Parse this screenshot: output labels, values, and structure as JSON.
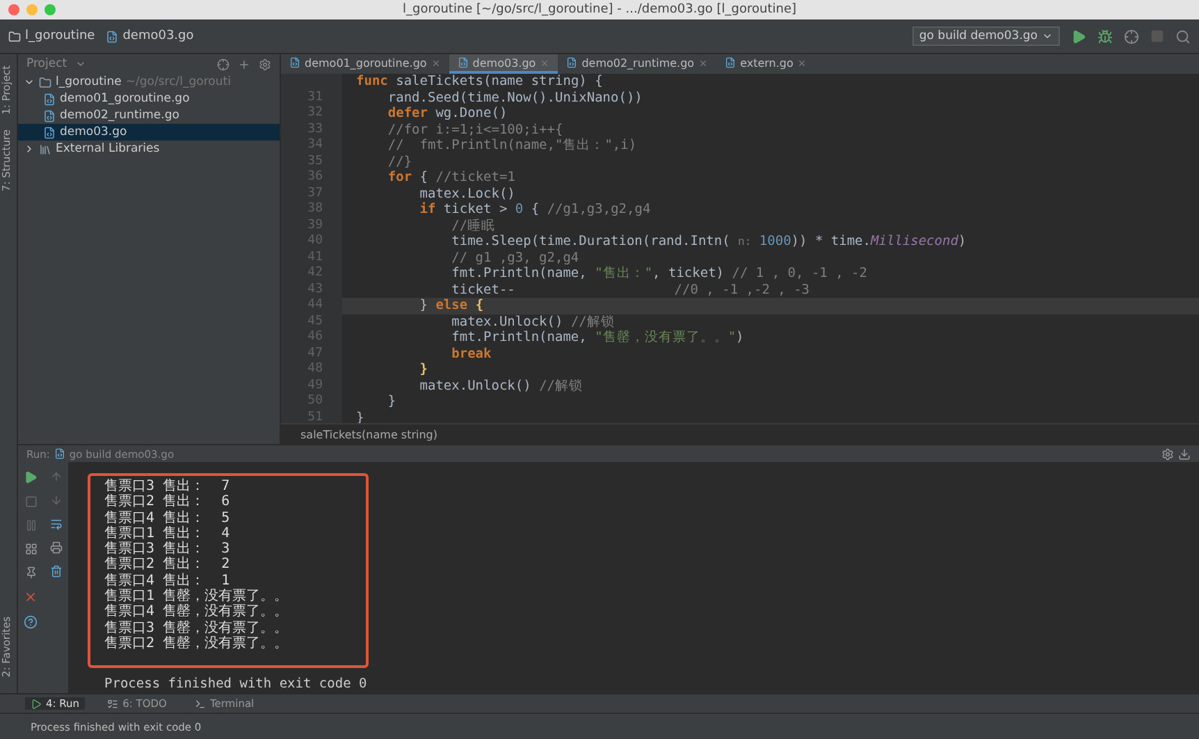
{
  "window": {
    "title": "l_goroutine [~/go/src/l_goroutine] - .../demo03.go [l_goroutine]"
  },
  "nav_bar": {
    "breadcrumbs": [
      "l_goroutine",
      "demo03.go"
    ],
    "run_config": "go build demo03.go"
  },
  "side_strip": {
    "top": [
      "1: Project",
      "7: Structure"
    ],
    "bottom": [
      "2: Favorites"
    ]
  },
  "project_panel": {
    "title": "Project",
    "tree": [
      {
        "label": "l_goroutine",
        "path": "~/go/src/l_gorouti",
        "kind": "folder",
        "expanded": true,
        "selected": false,
        "children": [
          {
            "label": "demo01_goroutine.go",
            "kind": "file",
            "selected": false
          },
          {
            "label": "demo02_runtime.go",
            "kind": "file",
            "selected": false
          },
          {
            "label": "demo03.go",
            "kind": "file",
            "selected": true
          }
        ]
      },
      {
        "label": "External Libraries",
        "kind": "library",
        "expanded": false,
        "selected": false
      }
    ]
  },
  "editor": {
    "tabs": [
      {
        "label": "demo01_goroutine.go",
        "selected": false
      },
      {
        "label": "demo03.go",
        "selected": true
      },
      {
        "label": "demo02_runtime.go",
        "selected": false
      },
      {
        "label": "extern.go",
        "selected": false
      }
    ],
    "lines": [
      {
        "current": false,
        "tokens": [
          {
            "kind": "kw",
            "t": "func "
          },
          {
            "kind": "plain",
            "t": "saleTickets(name string) {"
          }
        ]
      },
      {
        "number": "31",
        "current": false,
        "tokens": [
          {
            "kind": "plain",
            "t": "    rand.Seed(time.Now().UnixNano())"
          }
        ]
      },
      {
        "number": "32",
        "current": false,
        "tokens": [
          {
            "kind": "kw",
            "t": "    defer "
          },
          {
            "kind": "plain",
            "t": "wg.Done()"
          }
        ]
      },
      {
        "number": "33",
        "current": false,
        "tokens": [
          {
            "kind": "comment",
            "t": "    //for i:=1;i<=100;i++{"
          }
        ]
      },
      {
        "number": "34",
        "current": false,
        "tokens": [
          {
            "kind": "comment",
            "t": "    //  fmt.Println(name,\"售出：\",i)"
          }
        ]
      },
      {
        "number": "35",
        "current": false,
        "tokens": [
          {
            "kind": "comment",
            "t": "    //}"
          }
        ]
      },
      {
        "number": "36",
        "current": false,
        "tokens": [
          {
            "kind": "kw",
            "t": "    for "
          },
          {
            "kind": "plain",
            "t": "{ "
          },
          {
            "kind": "comment",
            "t": "//ticket=1"
          }
        ]
      },
      {
        "number": "37",
        "current": false,
        "tokens": [
          {
            "kind": "plain",
            "t": "        matex.Lock()"
          }
        ]
      },
      {
        "number": "38",
        "current": false,
        "tokens": [
          {
            "kind": "kw",
            "t": "        if "
          },
          {
            "kind": "plain",
            "t": "ticket > "
          },
          {
            "kind": "num",
            "t": "0"
          },
          {
            "kind": "plain",
            "t": " { "
          },
          {
            "kind": "comment",
            "t": "//g1,g3,g2,g4"
          }
        ]
      },
      {
        "number": "39",
        "current": false,
        "tokens": [
          {
            "kind": "comment",
            "t": "            //睡眠"
          }
        ]
      },
      {
        "number": "40",
        "current": false,
        "tokens": [
          {
            "kind": "plain",
            "t": "            time.Sleep(time.Duration(rand.Intn( "
          },
          {
            "kind": "hint",
            "t": "n:"
          },
          {
            "kind": "num",
            "t": " 1000"
          },
          {
            "kind": "plain",
            "t": ")) * time."
          },
          {
            "kind": "const",
            "t": "Millisecond"
          },
          {
            "kind": "plain",
            "t": ")"
          }
        ]
      },
      {
        "number": "41",
        "current": false,
        "tokens": [
          {
            "kind": "comment",
            "t": "            // g1 ,g3, g2,g4"
          }
        ]
      },
      {
        "number": "42",
        "current": false,
        "tokens": [
          {
            "kind": "plain",
            "t": "            fmt.Println(name, "
          },
          {
            "kind": "str",
            "t": "\"售出：\""
          },
          {
            "kind": "plain",
            "t": ", ticket) "
          },
          {
            "kind": "comment",
            "t": "// 1 , 0, -1 , -2"
          }
        ]
      },
      {
        "number": "43",
        "current": false,
        "tokens": [
          {
            "kind": "plain",
            "t": "            ticket--                    "
          },
          {
            "kind": "comment",
            "t": "//0 , -1 ,-2 , -3"
          }
        ]
      },
      {
        "number": "44",
        "current": true,
        "tokens": [
          {
            "kind": "plain",
            "t": "        } "
          },
          {
            "kind": "kw",
            "t": "else "
          },
          {
            "kind": "brace",
            "t": "{"
          }
        ]
      },
      {
        "number": "45",
        "current": false,
        "tokens": [
          {
            "kind": "plain",
            "t": "            matex.Unlock() "
          },
          {
            "kind": "comment",
            "t": "//解锁"
          }
        ]
      },
      {
        "number": "46",
        "current": false,
        "tokens": [
          {
            "kind": "plain",
            "t": "            fmt.Println(name, "
          },
          {
            "kind": "str",
            "t": "\"售罄，没有票了。。\""
          },
          {
            "kind": "plain",
            "t": ")"
          }
        ]
      },
      {
        "number": "47",
        "current": false,
        "tokens": [
          {
            "kind": "kw",
            "t": "            break"
          }
        ]
      },
      {
        "number": "48",
        "current": false,
        "tokens": [
          {
            "kind": "brace",
            "t": "        }"
          }
        ]
      },
      {
        "number": "49",
        "current": false,
        "tokens": [
          {
            "kind": "plain",
            "t": "        matex.Unlock() "
          },
          {
            "kind": "comment",
            "t": "//解锁"
          }
        ]
      },
      {
        "number": "50",
        "current": false,
        "tokens": [
          {
            "kind": "plain",
            "t": "    }"
          }
        ]
      },
      {
        "number": "51",
        "current": false,
        "tokens": [
          {
            "kind": "plain",
            "t": "}"
          }
        ]
      }
    ],
    "breadcrumb": "saleTickets(name string)"
  },
  "run_panel": {
    "title": "Run:",
    "config": "go build demo03.go",
    "output": [
      "售票口3 售出：  7",
      "售票口2 售出：  6",
      "售票口4 售出：  5",
      "售票口1 售出：  4",
      "售票口3 售出：  3",
      "售票口2 售出：  2",
      "售票口4 售出：  1",
      "售票口1 售罄，没有票了。。",
      "售票口4 售罄，没有票了。。",
      "售票口3 售罄，没有票了。。",
      "售票口2 售罄，没有票了。。"
    ],
    "exit_message": "Process finished with exit code 0"
  },
  "tool_tabs": [
    {
      "label": "4: Run",
      "selected": true
    },
    {
      "label": "6: TODO",
      "selected": false
    },
    {
      "label": "Terminal",
      "selected": false
    }
  ],
  "status_bar": {
    "message": "Process finished with exit code 0"
  }
}
